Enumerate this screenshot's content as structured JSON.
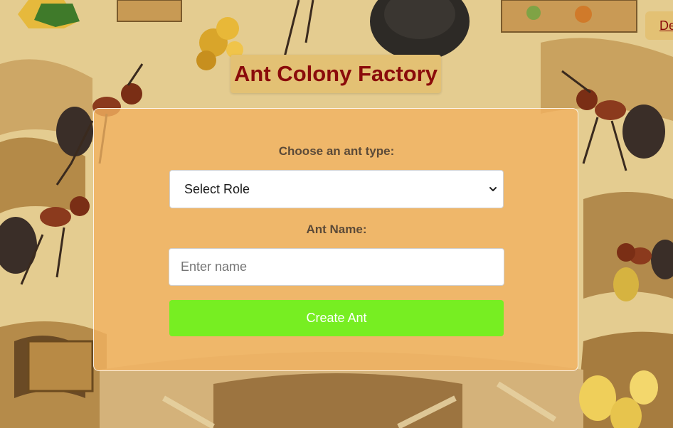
{
  "header": {
    "title": "Ant Colony Factory",
    "top_link_partial": "De"
  },
  "form": {
    "role_label": "Choose an ant type:",
    "role_select_value": "Select Role",
    "name_label": "Ant Name:",
    "name_placeholder": "Enter name",
    "name_value": "",
    "submit_label": "Create Ant"
  },
  "colors": {
    "title_text": "#8a0b0b",
    "title_bg": "#e3c174",
    "panel_bg": "#f1b260",
    "button_bg": "#77ee22",
    "button_text": "#ffffff",
    "label_text": "#5b4a38"
  },
  "icons": {
    "select_arrow": "chevron-down-icon"
  }
}
